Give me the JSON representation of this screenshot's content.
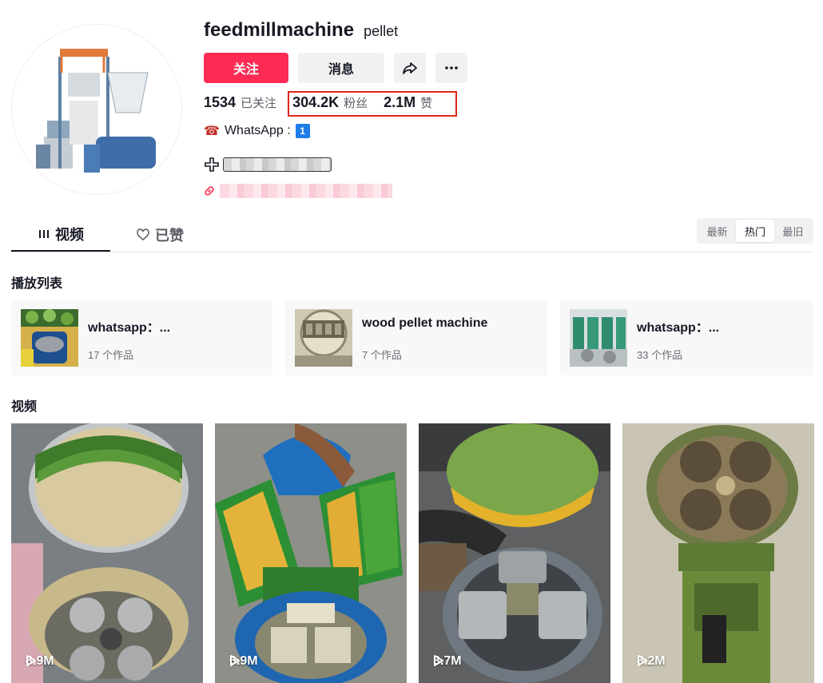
{
  "profile": {
    "username": "feedmillmachine",
    "nickname": "pellet",
    "follow_label": "关注",
    "message_label": "消息",
    "following_count": "1534",
    "following_label": "已关注",
    "followers_count": "304.2K",
    "followers_label": "粉丝",
    "likes_count": "2.1M",
    "likes_label": "赞",
    "bio_line": "WhatsApp :",
    "bio_badge": "1"
  },
  "tabs": {
    "videos": "视频",
    "liked": "已赞"
  },
  "sort": {
    "latest": "最新",
    "popular": "热门",
    "oldest": "最旧",
    "active": "popular"
  },
  "sections": {
    "playlists": "播放列表",
    "videos": "视频"
  },
  "playlists": [
    {
      "title": "whatsapp：...",
      "count": "17 个作品"
    },
    {
      "title": "wood pellet machine",
      "count": "7 个作品"
    },
    {
      "title": "whatsapp：...",
      "count": "33 个作品"
    }
  ],
  "videos": [
    {
      "views": "8.9M"
    },
    {
      "views": "6.9M"
    },
    {
      "views": "3.7M"
    },
    {
      "views": "3.2M"
    }
  ],
  "colors": {
    "accent": "#fe2c55",
    "highlight": "#e1251b"
  }
}
